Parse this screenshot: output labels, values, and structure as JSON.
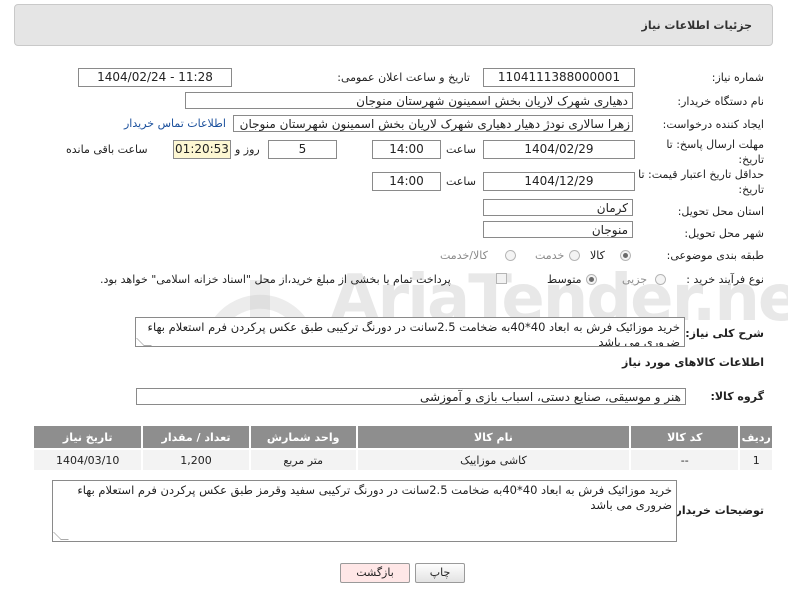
{
  "header": {
    "title": "جزئیات اطلاعات نیاز"
  },
  "watermark": "AriaTender.net",
  "form": {
    "need_number_label": "شماره نیاز:",
    "need_number": "1104111388000001",
    "announce_label": "تاریخ و ساعت اعلان عمومی:",
    "announce_value": "1404/02/24 - 11:28",
    "buyer_org_label": "نام دستگاه خریدار:",
    "buyer_org": "دهیاری شهرک لاریان بخش اسمینون شهرستان منوجان",
    "requester_label": "ایجاد کننده درخواست:",
    "requester": "زهرا سالاری نودژ دهیار  دهیاری شهرک لاریان بخش اسمینون شهرستان منوجان",
    "contact_link": "اطلاعات تماس خریدار",
    "reply_deadline_label": "مهلت ارسال پاسخ: تا تاریخ:",
    "reply_date": "1404/02/29",
    "time_label": "ساعت",
    "reply_time": "14:00",
    "days_value": "5",
    "days_label": "روز و",
    "remaining_time": "01:20:53",
    "remaining_label": "ساعت باقی مانده",
    "price_validity_label": "حداقل تاریخ اعتبار قیمت: تا تاریخ:",
    "validity_date": "1404/12/29",
    "validity_time": "14:00",
    "province_label": "استان محل تحویل:",
    "province": "کرمان",
    "city_label": "شهر محل تحویل:",
    "city": "منوجان",
    "category_label": "طبقه بندی موضوعی:",
    "category_options": [
      "کالا",
      "خدمت",
      "کالا/خدمت"
    ],
    "category_selected": "کالا",
    "process_label": "نوع فرآیند خرید :",
    "process_options": [
      "جزیی",
      "متوسط"
    ],
    "process_selected": "متوسط",
    "treasury_note": "پرداخت تمام یا بخشی از مبلغ خرید،از محل \"اسناد خزانه اسلامی\" خواهد بود.",
    "description_label": "شرح کلی نیاز:",
    "description": "خرید موزائیک فرش به ابعاد 40*40به ضخامت 2.5سانت در دورنگ ترکیبی  طبق عکس پرکردن فرم استعلام بهاء ضروری می باشد"
  },
  "goods": {
    "section_title": "اطلاعات کالاهای مورد نیاز",
    "group_label": "گروه کالا:",
    "group_value": "هنر و موسیقی، صنایع دستی، اسباب بازی و آموزشی",
    "columns": [
      "ردیف",
      "کد کالا",
      "نام کالا",
      "واحد شمارش",
      "تعداد / مقدار",
      "تاریخ نیاز"
    ],
    "rows": [
      [
        "1",
        "--",
        "کاشی موزاییک",
        "متر مربع",
        "1,200",
        "1404/03/10"
      ]
    ]
  },
  "buyer_notes": {
    "label": "توضیحات خریدار:",
    "text": "خرید موزائیک فرش به ابعاد 40*40به ضخامت 2.5سانت در دورنگ ترکیبی سفید وقرمز  طبق عکس پرکردن فرم استعلام بهاء ضروری می باشد"
  },
  "buttons": {
    "print": "چاپ",
    "back": "بازگشت"
  },
  "colors": {
    "link": "#1a4f9c",
    "table_header": "#8e8e8e",
    "back_button_bg": "#ffe7e7"
  }
}
